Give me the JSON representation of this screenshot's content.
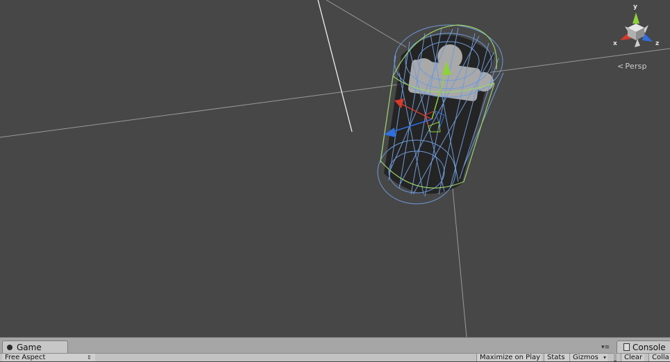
{
  "scene_view": {
    "projection_label": "Persp",
    "axis_labels": {
      "x": "x",
      "y": "y",
      "z": "z"
    }
  },
  "game_panel": {
    "tab_label": "Game",
    "aspect_value": "Free Aspect",
    "maximize_label": "Maximize on Play",
    "stats_label": "Stats",
    "gizmos_label": "Gizmos"
  },
  "console_panel": {
    "tab_label": "Console",
    "clear_label": "Clear",
    "collapse_label": "Colla"
  },
  "colors": {
    "scene_bg": "#474747",
    "wire_blue": "#6f9bd9",
    "wire_green": "#9bd46a",
    "axis_red": "#d63a2a",
    "axis_green": "#8fd13a",
    "axis_blue": "#2f6fe0"
  }
}
